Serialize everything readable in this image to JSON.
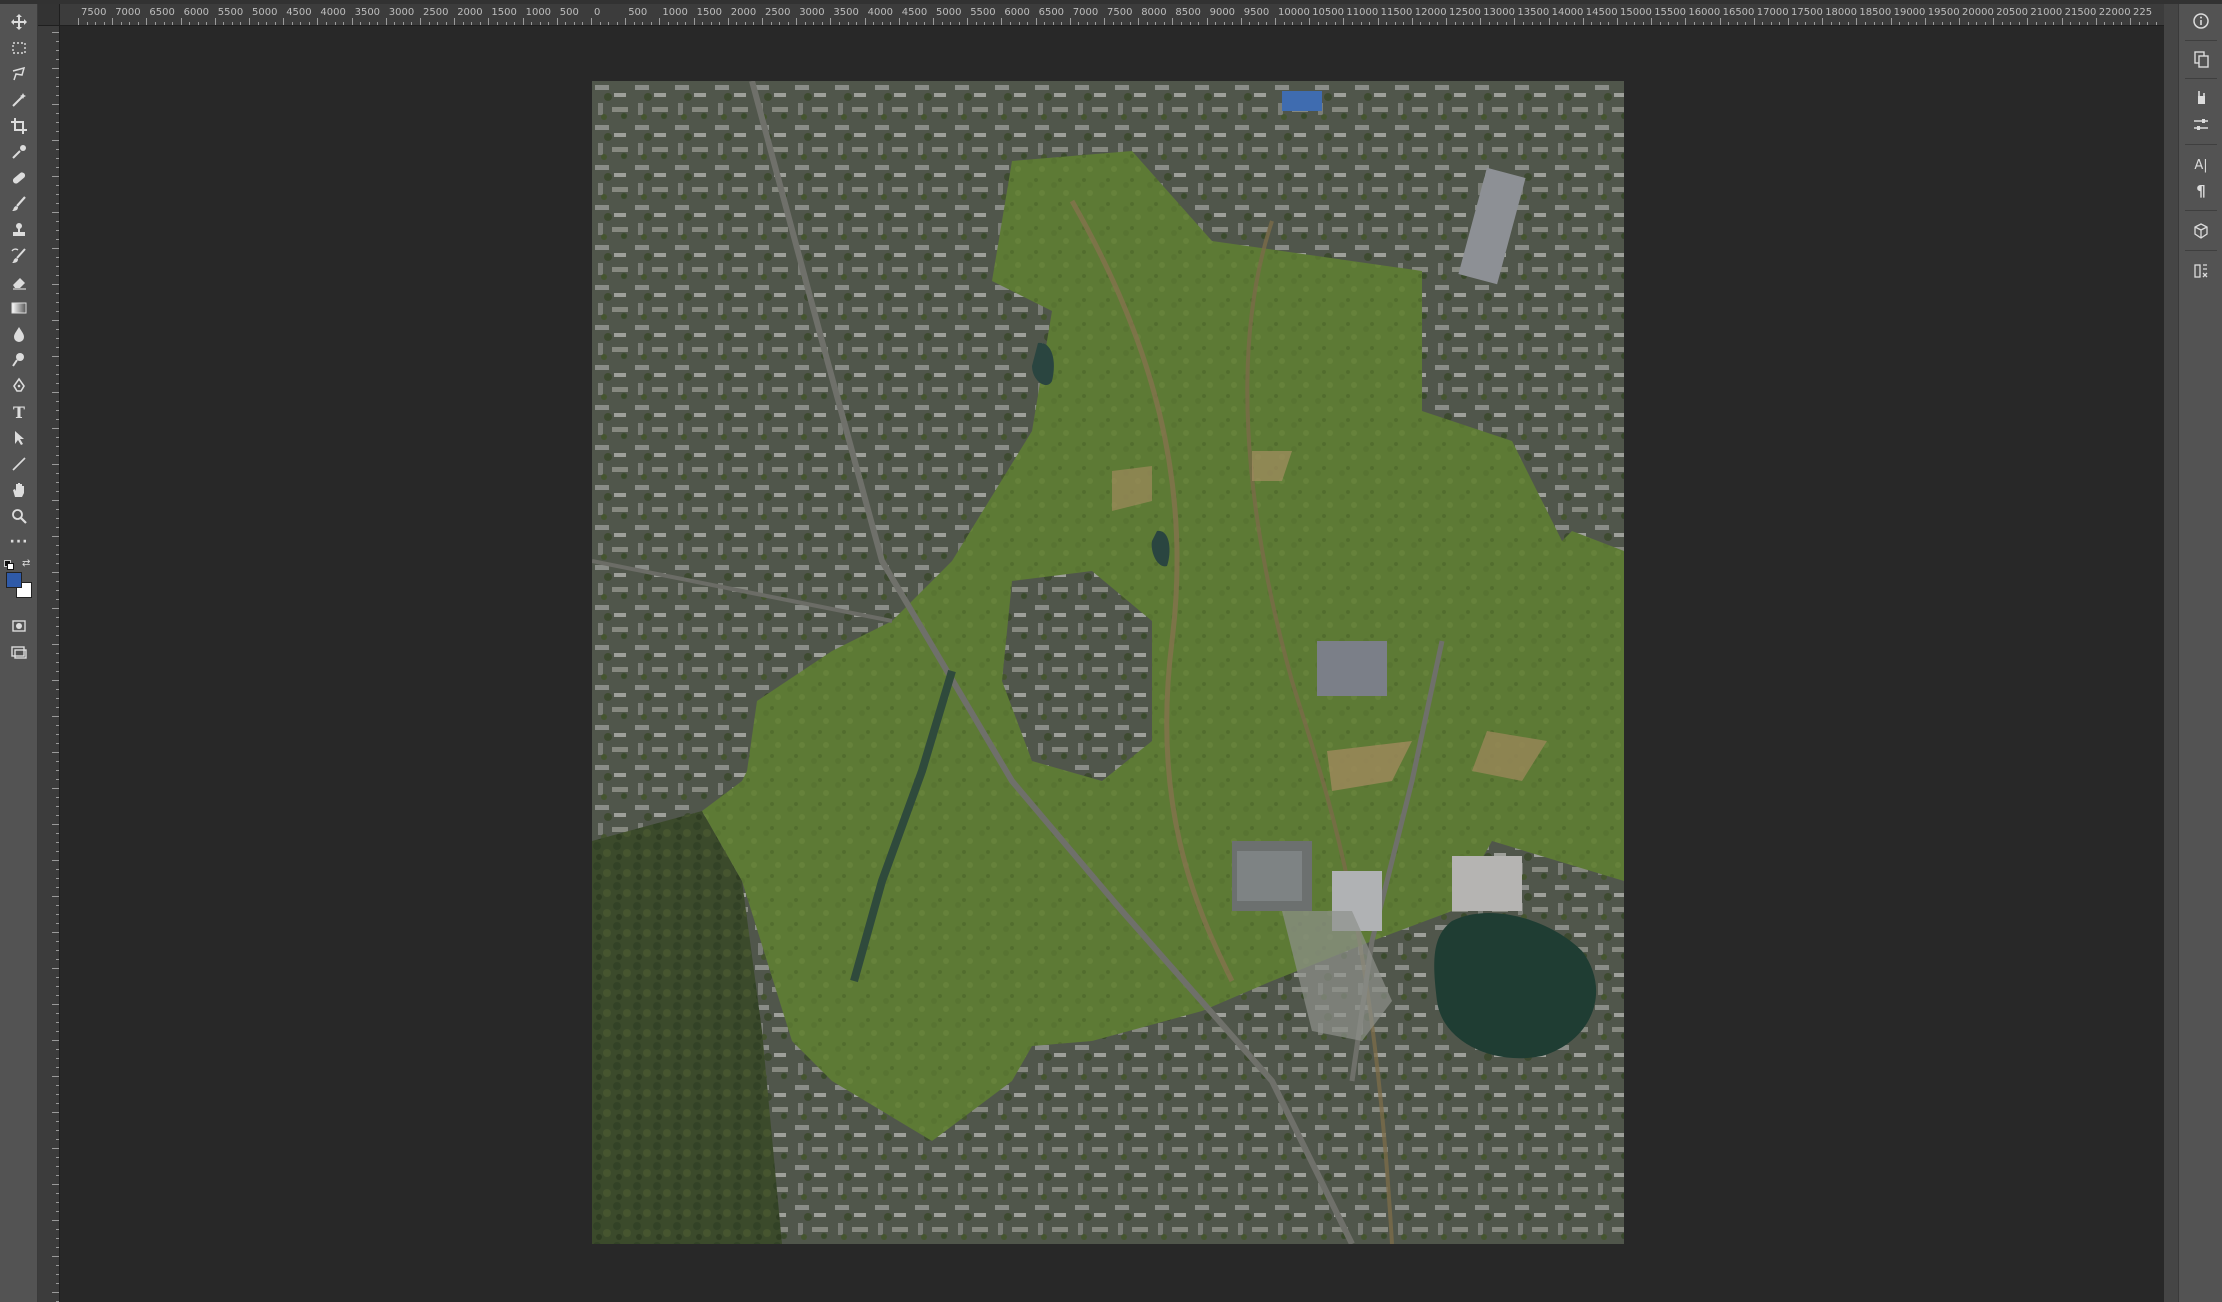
{
  "app": "Photoshop",
  "ruler_top_labels": [
    "7500",
    "7000",
    "6500",
    "6000",
    "5500",
    "5000",
    "4500",
    "4000",
    "3500",
    "3000",
    "2500",
    "2000",
    "1500",
    "1000",
    "500",
    "0",
    "500",
    "1000",
    "1500",
    "2000",
    "2500",
    "3000",
    "3500",
    "4000",
    "4500",
    "5000",
    "5500",
    "6000",
    "6500",
    "7000",
    "7500",
    "8000",
    "8500",
    "9000",
    "9500",
    "10000",
    "10500",
    "11000",
    "11500",
    "12000",
    "12500",
    "13000",
    "13500",
    "14000",
    "14500",
    "15000",
    "15500",
    "16000",
    "16500",
    "17000",
    "17500",
    "18000",
    "18500",
    "19000",
    "19500",
    "20000",
    "20500",
    "21000",
    "21500",
    "22000",
    "225"
  ],
  "toolbar": {
    "tools": [
      {
        "name": "move-tool",
        "icon": "move-icon"
      },
      {
        "name": "marquee-tool",
        "icon": "rect-marquee-icon"
      },
      {
        "name": "lasso-tool",
        "icon": "lasso-icon"
      },
      {
        "name": "magic-wand-tool",
        "icon": "magic-wand-icon"
      },
      {
        "name": "crop-tool",
        "icon": "crop-icon"
      },
      {
        "name": "eyedropper-tool",
        "icon": "eyedropper-icon"
      },
      {
        "name": "healing-tool",
        "icon": "bandage-icon"
      },
      {
        "name": "brush-tool",
        "icon": "brush-icon"
      },
      {
        "name": "stamp-tool",
        "icon": "stamp-icon"
      },
      {
        "name": "history-brush-tool",
        "icon": "history-brush-icon"
      },
      {
        "name": "eraser-tool",
        "icon": "eraser-icon"
      },
      {
        "name": "gradient-tool",
        "icon": "gradient-icon"
      },
      {
        "name": "blur-tool",
        "icon": "drop-icon"
      },
      {
        "name": "dodge-tool",
        "icon": "dodge-icon"
      },
      {
        "name": "pen-tool",
        "icon": "pen-icon"
      },
      {
        "name": "type-tool",
        "icon": "type-icon",
        "label": "T"
      },
      {
        "name": "path-selection-tool",
        "icon": "arrow-icon"
      },
      {
        "name": "line-tool",
        "icon": "line-icon"
      },
      {
        "name": "hand-tool",
        "icon": "hand-icon"
      },
      {
        "name": "zoom-tool",
        "icon": "zoom-icon"
      },
      {
        "name": "more-tools",
        "icon": "ellipsis-icon",
        "label": "···"
      }
    ],
    "foreground_color": "#2f5aa8",
    "background_color": "#ffffff"
  },
  "right_panel": {
    "buttons": [
      {
        "name": "info-panel-button",
        "icon": "info-icon"
      },
      {
        "name": "history-panel-button",
        "icon": "history-icon"
      },
      {
        "name": "adjustments-panel-button",
        "icon": "adjustments-icon"
      },
      {
        "name": "properties-panel-button",
        "icon": "sliders-icon"
      },
      {
        "name": "character-panel-button",
        "icon": "character-icon",
        "label": "A|"
      },
      {
        "name": "paragraph-panel-button",
        "icon": "paragraph-icon",
        "label": "¶"
      },
      {
        "name": "3d-panel-button",
        "icon": "cube-icon"
      },
      {
        "name": "layers-panel-button",
        "icon": "layers-icon"
      }
    ]
  },
  "document": {
    "content": "aerial-satellite-image",
    "colors": {
      "urban": "#5b5e55",
      "greenfield": "#5d7a35",
      "lake": "#1f3d33",
      "forest": "#3d4f2a"
    }
  }
}
